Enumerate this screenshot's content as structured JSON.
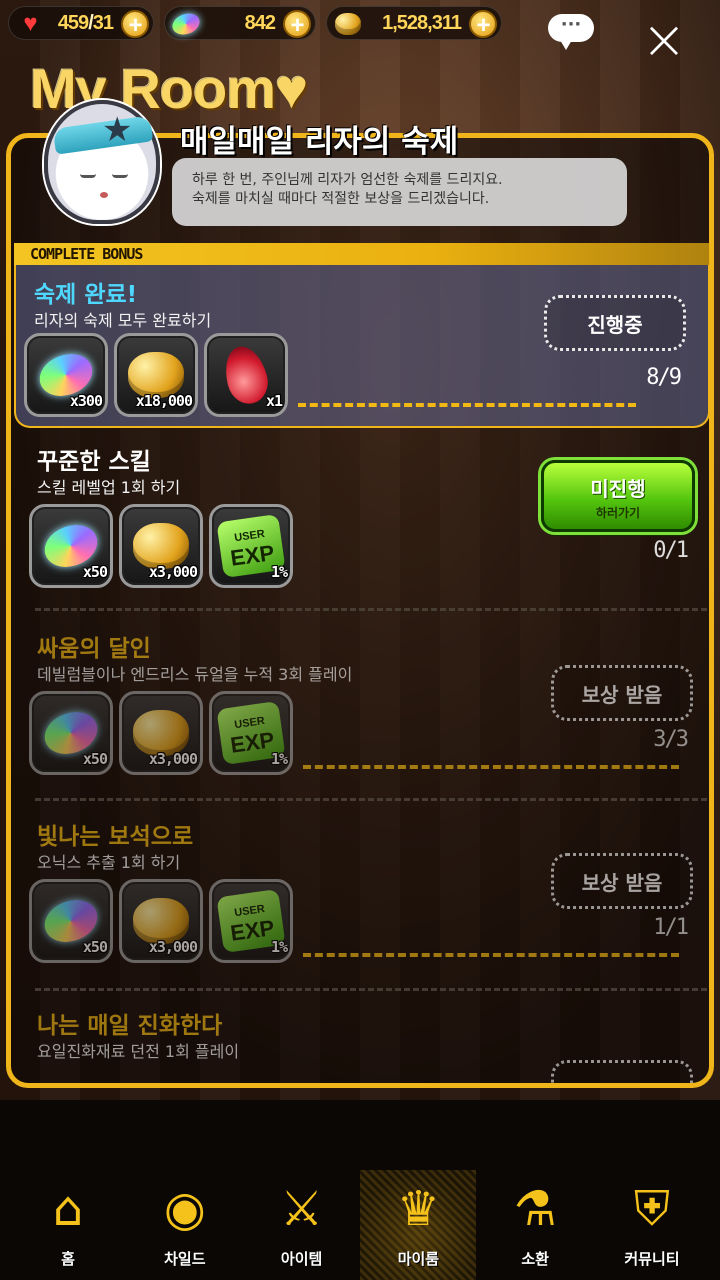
{
  "topbar": {
    "hearts": {
      "icon": "heart-icon",
      "current": "459",
      "max": "31"
    },
    "gems": {
      "icon": "gem-icon",
      "value": "842"
    },
    "gold": {
      "icon": "gold-coin-icon",
      "value": "1,528,311"
    },
    "chat_label": "···"
  },
  "page_title": "My Room♥",
  "quest_title": "매일매일 리자의 숙제",
  "speech": {
    "line1": "하루 한 번, 주인님께 리자가 엄선한 숙제를 드리지요.",
    "line2": "숙제를 마치실 때마다 적절한 보상을 드리겠습니다."
  },
  "complete_bonus_label": "COMPLETE BONUS",
  "quests": [
    {
      "name": "숙제 완료!",
      "desc": "리자의 숙제 모두 완료하기",
      "rewards": [
        {
          "icon": "gem-icon",
          "qty": "x300"
        },
        {
          "icon": "gold-coin-icon",
          "qty": "x18,000"
        },
        {
          "icon": "ruby-icon",
          "qty": "x1"
        }
      ],
      "status": "진행중",
      "progress": "8/9"
    },
    {
      "name": "꾸준한 스킬",
      "desc": "스킬 레벨업 1회 하기",
      "rewards": [
        {
          "icon": "gem-icon",
          "qty": "x50"
        },
        {
          "icon": "gold-coin-icon",
          "qty": "x3,000"
        },
        {
          "icon": "exp-icon",
          "qty": "1%"
        }
      ],
      "status": "미진행",
      "status_sub": "하러가기",
      "progress": "0/1"
    },
    {
      "name": "싸움의 달인",
      "desc": "데빌럼블이나 엔드리스 듀얼을 누적 3회 플레이",
      "rewards": [
        {
          "icon": "gem-icon",
          "qty": "x50"
        },
        {
          "icon": "gold-coin-icon",
          "qty": "x3,000"
        },
        {
          "icon": "exp-icon",
          "qty": "1%"
        }
      ],
      "status": "보상 받음",
      "progress": "3/3"
    },
    {
      "name": "빛나는 보석으로",
      "desc": "오닉스 추출 1회 하기",
      "rewards": [
        {
          "icon": "gem-icon",
          "qty": "x50"
        },
        {
          "icon": "gold-coin-icon",
          "qty": "x3,000"
        },
        {
          "icon": "exp-icon",
          "qty": "1%"
        }
      ],
      "status": "보상 받음",
      "progress": "1/1"
    },
    {
      "name": "나는 매일 진화한다",
      "desc": "요일진화재료 던전 1회 플레이"
    }
  ],
  "exp_icon_text": {
    "top": "USER",
    "bottom": "EXP"
  },
  "nav": [
    {
      "label": "홈",
      "icon": "home-arch-icon"
    },
    {
      "label": "차일드",
      "icon": "flame-eye-icon"
    },
    {
      "label": "아이템",
      "icon": "sword-shield-icon"
    },
    {
      "label": "마이룸",
      "icon": "crown-laurel-icon",
      "active": true
    },
    {
      "label": "소환",
      "icon": "potion-heart-icon"
    },
    {
      "label": "커뮤니티",
      "icon": "checkered-shield-icon"
    }
  ],
  "colors": {
    "accent": "#f0b51b",
    "bonus_title": "#4fd8ff",
    "go_button": "#55c60e"
  }
}
